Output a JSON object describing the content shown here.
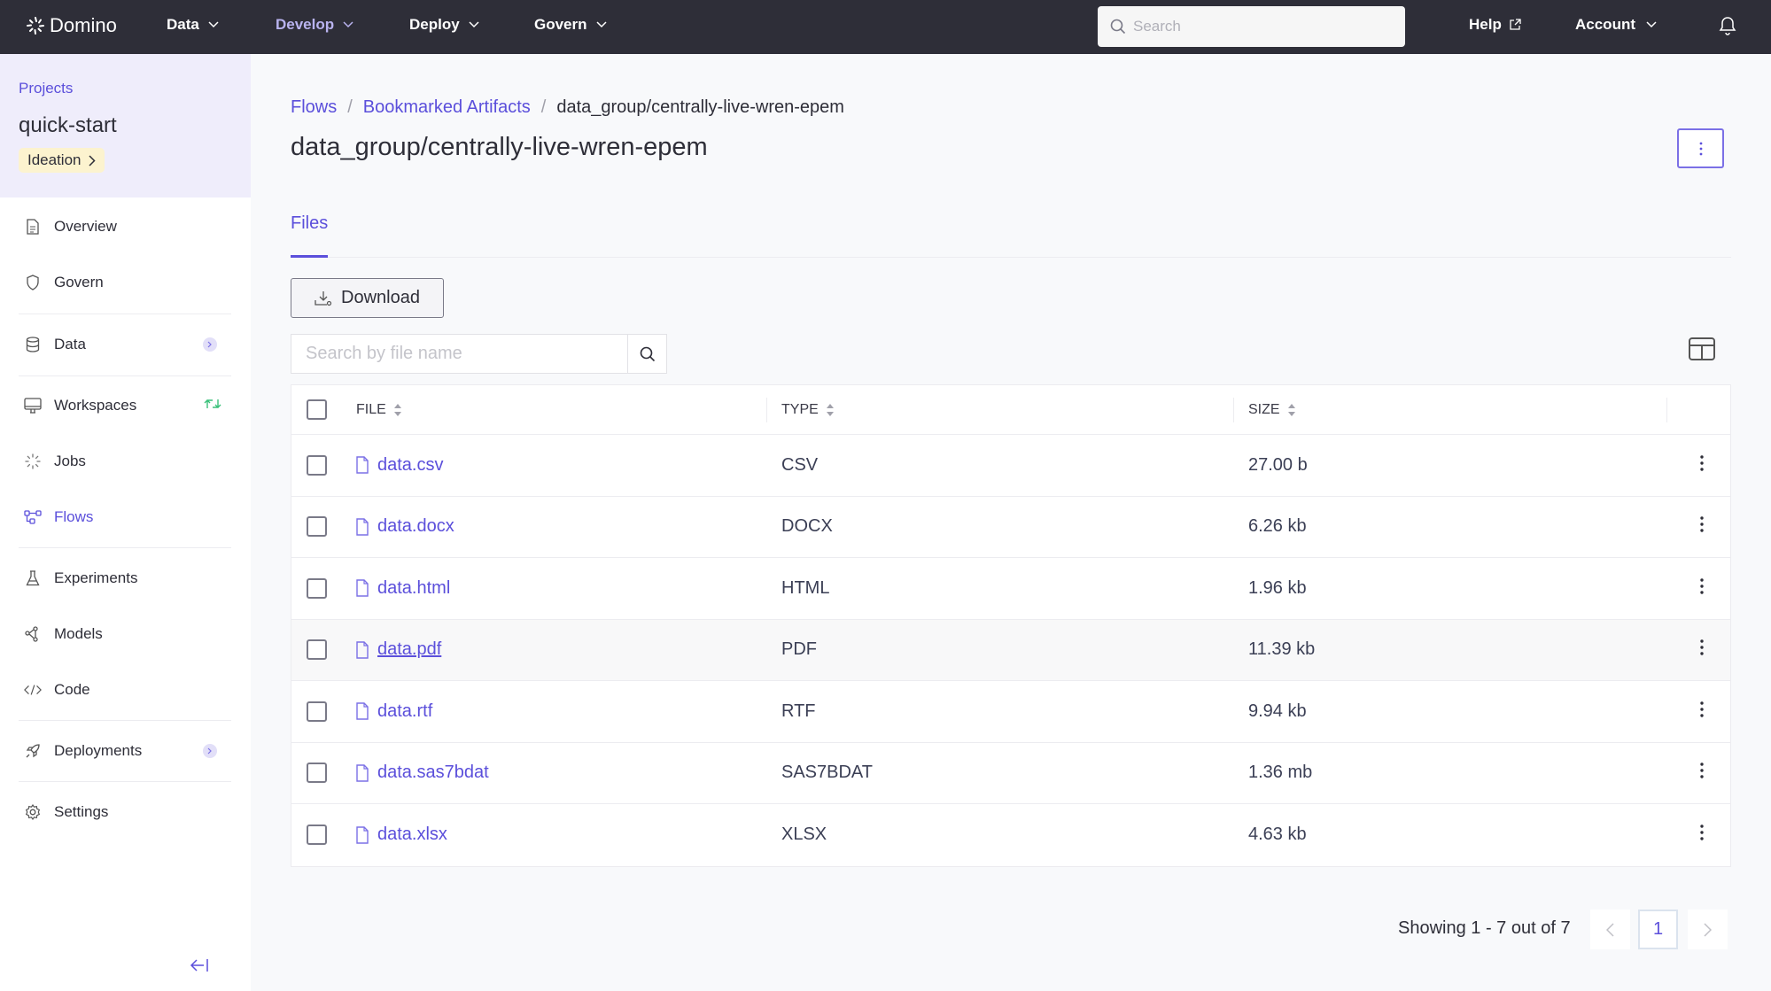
{
  "topnav": {
    "brand": "Domino",
    "items": [
      {
        "label": "Data",
        "active": false
      },
      {
        "label": "Develop",
        "active": true
      },
      {
        "label": "Deploy",
        "active": false
      },
      {
        "label": "Govern",
        "active": false
      }
    ],
    "search_placeholder": "Search",
    "help_label": "Help",
    "account_label": "Account"
  },
  "sidebar": {
    "projects_link": "Projects",
    "project_name": "quick-start",
    "stage": "Ideation",
    "items": [
      {
        "label": "Overview",
        "icon": "document-icon"
      },
      {
        "label": "Govern",
        "icon": "shield-icon"
      },
      {
        "label": "Data",
        "icon": "database-icon",
        "has_submenu": true
      },
      {
        "label": "Workspaces",
        "icon": "monitor-icon",
        "status": "sync"
      },
      {
        "label": "Jobs",
        "icon": "spinner-icon"
      },
      {
        "label": "Flows",
        "icon": "flows-icon",
        "active": true
      },
      {
        "label": "Experiments",
        "icon": "flask-icon"
      },
      {
        "label": "Models",
        "icon": "models-icon"
      },
      {
        "label": "Code",
        "icon": "code-icon"
      },
      {
        "label": "Deployments",
        "icon": "rocket-icon",
        "has_submenu": true
      },
      {
        "label": "Settings",
        "icon": "gear-icon"
      }
    ]
  },
  "breadcrumb": {
    "items": [
      "Flows",
      "Bookmarked Artifacts"
    ],
    "current": "data_group/centrally-live-wren-epem"
  },
  "page_title": "data_group/centrally-live-wren-epem",
  "tabs": [
    {
      "label": "Files",
      "active": true
    }
  ],
  "download_label": "Download",
  "file_search_placeholder": "Search by file name",
  "table": {
    "headers": {
      "file": "FILE",
      "type": "TYPE",
      "size": "SIZE"
    },
    "rows": [
      {
        "name": "data.csv",
        "type": "CSV",
        "size": "27.00 b"
      },
      {
        "name": "data.docx",
        "type": "DOCX",
        "size": "6.26 kb"
      },
      {
        "name": "data.html",
        "type": "HTML",
        "size": "1.96 kb"
      },
      {
        "name": "data.pdf",
        "type": "PDF",
        "size": "11.39 kb",
        "hovered": true
      },
      {
        "name": "data.rtf",
        "type": "RTF",
        "size": "9.94 kb"
      },
      {
        "name": "data.sas7bdat",
        "type": "SAS7BDAT",
        "size": "1.36 mb"
      },
      {
        "name": "data.xlsx",
        "type": "XLSX",
        "size": "4.63 kb"
      }
    ]
  },
  "pagination": {
    "summary": "Showing 1 - 7 out of 7",
    "current_page": "1"
  },
  "colors": {
    "accent": "#5b4fdb",
    "topnav_bg": "#2e2e38",
    "sidebar_header_bg": "#efedfb",
    "stage_badge_bg": "#fcf3cf",
    "sync_green": "#3ac07a"
  }
}
